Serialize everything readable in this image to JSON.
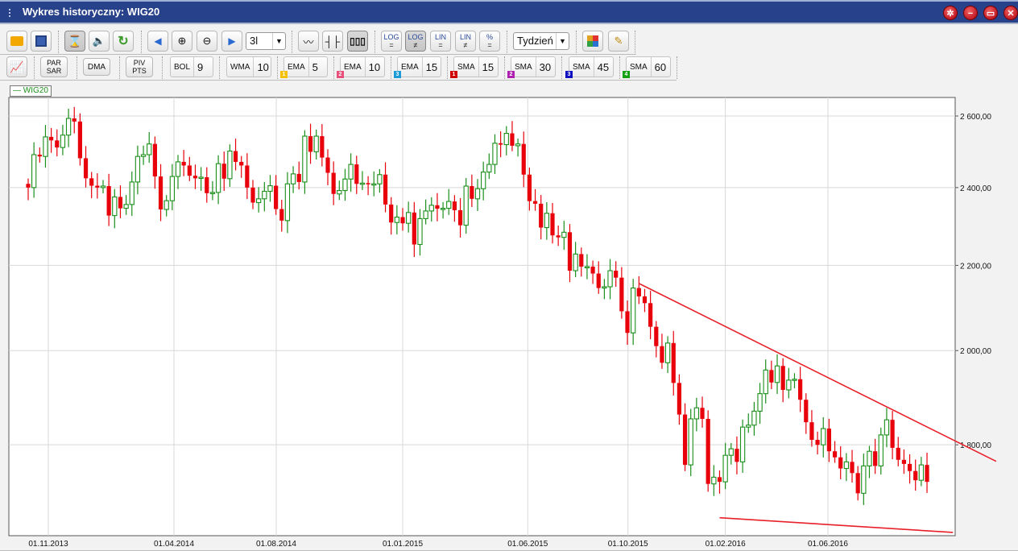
{
  "window": {
    "title": "Wykres historyczny: WIG20",
    "buttons": [
      "settings",
      "minimize",
      "restore",
      "close"
    ]
  },
  "toolbar": {
    "period_select": "3l",
    "interval_select": "Tydzień",
    "log_eq": "LOG",
    "lin_eq": "LIN",
    "pct": "%",
    "eq": "=",
    "neq": "≠"
  },
  "indicators": {
    "par_sar": [
      "PAR",
      "SAR"
    ],
    "dma": "DMA",
    "piv_pts": [
      "PIV",
      "PTS"
    ],
    "items": [
      {
        "name": "BOL",
        "value": "9",
        "badge": "",
        "color": ""
      },
      {
        "name": "WMA",
        "value": "10",
        "badge": "",
        "color": ""
      },
      {
        "name": "EMA",
        "value": "5",
        "badge": "1",
        "color": "#f5c000"
      },
      {
        "name": "EMA",
        "value": "10",
        "badge": "2",
        "color": "#e8507a"
      },
      {
        "name": "EMA",
        "value": "15",
        "badge": "3",
        "color": "#1a9ad6"
      },
      {
        "name": "SMA",
        "value": "15",
        "badge": "1",
        "color": "#d00000"
      },
      {
        "name": "SMA",
        "value": "30",
        "badge": "2",
        "color": "#b020b0"
      },
      {
        "name": "SMA",
        "value": "45",
        "badge": "3",
        "color": "#1010c0"
      },
      {
        "name": "SMA",
        "value": "60",
        "badge": "4",
        "color": "#10a010"
      }
    ]
  },
  "chart_data": {
    "type": "candlestick",
    "title": "WIG20",
    "legend": "WIG20",
    "legend_position": "top-left",
    "interval": "weekly",
    "scale": "log",
    "ylim": [
      1625,
      2654
    ],
    "y_ticks": [
      2600,
      2400,
      2200,
      2000,
      1800
    ],
    "y_tick_labels": [
      "2 600,00",
      "2 400,00",
      "2 200,00",
      "2 000,00",
      "1 800,00"
    ],
    "x_ticks": [
      {
        "index": 3.5,
        "label": "01.11.2013"
      },
      {
        "index": 25.3,
        "label": "01.04.2014"
      },
      {
        "index": 43.05,
        "label": "01.08.2014"
      },
      {
        "index": 65.0,
        "label": "01.01.2015"
      },
      {
        "index": 86.7,
        "label": "01.06.2015"
      },
      {
        "index": 104.1,
        "label": "01.10.2015"
      },
      {
        "index": 121.0,
        "label": "01.02.2016"
      },
      {
        "index": 138.8,
        "label": "01.06.2016"
      }
    ],
    "first_open": 2410,
    "close": [
      2400,
      2490,
      2485,
      2540,
      2530,
      2510,
      2545,
      2593,
      2584,
      2480,
      2425,
      2405,
      2400,
      2404,
      2326,
      2375,
      2345,
      2355,
      2415,
      2485,
      2490,
      2520,
      2430,
      2342,
      2365,
      2430,
      2470,
      2460,
      2432,
      2425,
      2428,
      2385,
      2387,
      2465,
      2424,
      2500,
      2470,
      2460,
      2400,
      2360,
      2370,
      2390,
      2405,
      2343,
      2313,
      2410,
      2437,
      2415,
      2542,
      2498,
      2542,
      2482,
      2440,
      2383,
      2392,
      2423,
      2463,
      2410,
      2412,
      2410,
      2410,
      2435,
      2355,
      2308,
      2322,
      2306,
      2334,
      2252,
      2318,
      2338,
      2353,
      2344,
      2345,
      2363,
      2340,
      2301,
      2404,
      2370,
      2397,
      2442,
      2463,
      2522,
      2518,
      2550,
      2515,
      2520,
      2435,
      2364,
      2357,
      2295,
      2332,
      2275,
      2270,
      2283,
      2187,
      2228,
      2197,
      2197,
      2180,
      2145,
      2148,
      2187,
      2170,
      2090,
      2040,
      2145,
      2125,
      2109,
      2054,
      2010,
      1973,
      2017,
      1929,
      1862,
      1760,
      1853,
      1876,
      1853,
      1723,
      1736,
      1727,
      1779,
      1792,
      1766,
      1836,
      1840,
      1869,
      1906,
      1957,
      1930,
      1966,
      1914,
      1935,
      1937,
      1893,
      1846,
      1810,
      1800,
      1833,
      1787,
      1775,
      1753,
      1766,
      1744,
      1705,
      1758,
      1787,
      1758,
      1820,
      1851,
      1794,
      1770,
      1762,
      1748,
      1730,
      1760,
      1727
    ],
    "trendlines": [
      {
        "name": "resistance",
        "color": "#e8202a",
        "from": {
          "index": 106,
          "price": 2156
        },
        "to": {
          "index": 168,
          "price": 1767
        }
      },
      {
        "name": "support",
        "color": "#e8202a",
        "from": {
          "index": 120,
          "price": 1659
        },
        "to": {
          "index": 160.5,
          "price": 1632
        }
      }
    ],
    "colors": {
      "up": "#1a8f1a",
      "down": "#e8000b",
      "grid": "#d8d8d8"
    }
  }
}
